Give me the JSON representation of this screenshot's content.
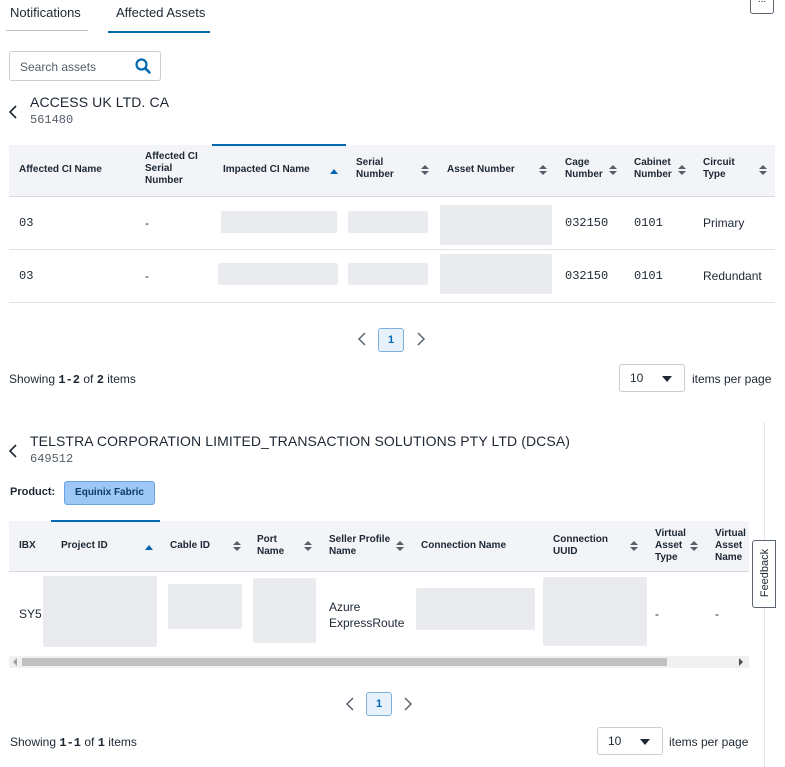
{
  "tabs": [
    {
      "label": "Notifications"
    },
    {
      "label": "Affected Assets"
    }
  ],
  "more_label": "...",
  "search": {
    "placeholder": "Search assets"
  },
  "accounts": [
    {
      "name": "ACCESS UK LTD. CA",
      "number": "561480",
      "columns": [
        "Affected CI Name",
        "Affected CI Serial Number",
        "Impacted CI Name",
        "Serial Number",
        "Asset Number",
        "Cage Number",
        "Cabinet Number",
        "Circuit Type"
      ],
      "rows": [
        {
          "ci_name": "03",
          "ci_serial": "-",
          "cage": "032150",
          "cabinet": "0101",
          "circuit": "Primary"
        },
        {
          "ci_name": "03",
          "ci_serial": "-",
          "cage": "032150",
          "cabinet": "0101",
          "circuit": "Redundant"
        }
      ],
      "page": "1",
      "showing_prefix": "Showing",
      "showing_range": "1-2",
      "showing_of": "of",
      "showing_total": "2",
      "showing_suffix": "items",
      "per_page": "10",
      "per_page_label": "items per page"
    },
    {
      "name": "TELSTRA CORPORATION LIMITED_TRANSACTION SOLUTIONS PTY LTD (DCSA)",
      "number": "649512",
      "product_label": "Product:",
      "product": "Equinix Fabric",
      "columns": [
        "IBX",
        "Project ID",
        "Cable ID",
        "Port Name",
        "Seller Profile Name",
        "Connection Name",
        "Connection UUID",
        "Virtual Asset Type",
        "Virtual Asset Name"
      ],
      "rows": [
        {
          "ibx": "SY5",
          "seller": "Azure ExpressRoute",
          "vat": "-",
          "van": "-"
        }
      ],
      "page": "1",
      "showing_prefix": "Showing",
      "showing_range": "1-1",
      "showing_of": "of",
      "showing_total": "1",
      "showing_suffix": "items",
      "per_page": "10",
      "per_page_label": "items per page"
    }
  ],
  "feedback_label": "Feedback",
  "colors": {
    "accent": "#0067b1",
    "header_bg": "#f2f4f7",
    "chip_bg": "#9dc8f5"
  }
}
